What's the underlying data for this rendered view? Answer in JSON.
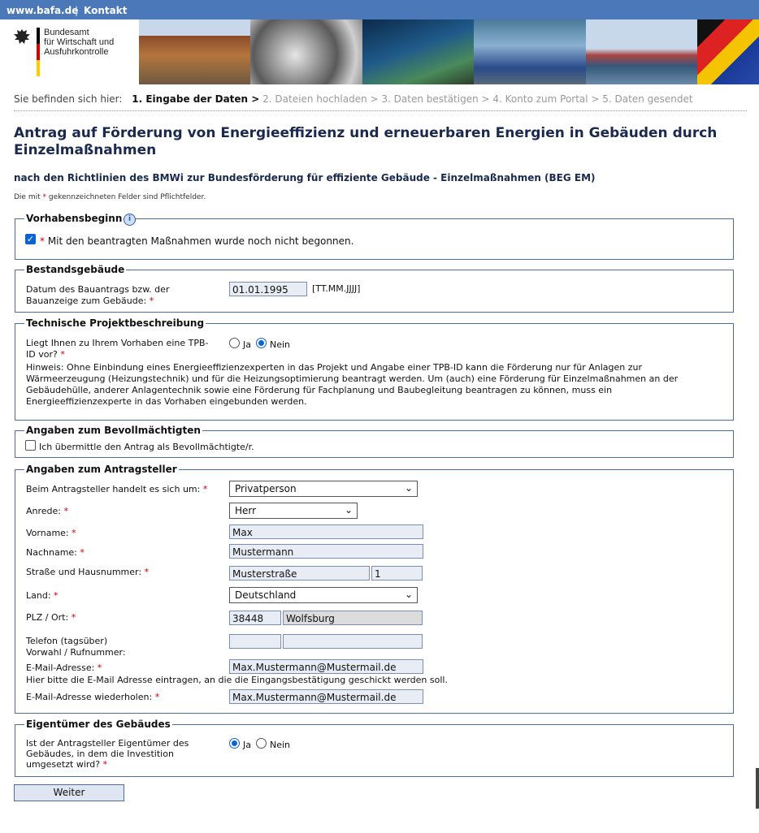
{
  "topbar": {
    "site": "www.bafa.de",
    "sep": "|",
    "contact": "Kontakt"
  },
  "logo": {
    "line1": "Bundesamt",
    "line2": "für Wirtschaft und",
    "line3": "Ausfuhrkontrolle"
  },
  "breadcrumb": {
    "prefix": "Sie befinden sich hier:",
    "current": "1. Eingabe der Daten >",
    "rest": "2. Dateien hochladen > 3. Daten bestätigen > 4. Konto zum Portal > 5. Daten gesendet"
  },
  "page": {
    "title": "Antrag auf Förderung von Energieeffizienz und erneuerbaren Energien in Gebäuden durch Einzelmaßnahmen",
    "subtitle": "nach den Richtlinien des BMWi zur Bundesförderung für effiziente Gebäude - Einzelmaßnahmen (BEG EM)",
    "req_note_pre": "Die mit ",
    "req_star": "*",
    "req_note_post": " gekennzeichneten Felder sind Pflichtfelder."
  },
  "vorhaben": {
    "legend": "Vorhabensbeginn",
    "info": "i",
    "checkbox_label": "Mit den beantragten Maßnahmen wurde noch nicht begonnen.",
    "checked": true
  },
  "bestand": {
    "legend": "Bestandsgebäude",
    "label_line1": "Datum des Bauantrags bzw. der",
    "label_line2": "Bauanzeige zum Gebäude:",
    "value": "01.01.1995",
    "format": "[TT.MM.JJJJ]"
  },
  "technik": {
    "legend": "Technische Projektbeschreibung",
    "question_line1": "Liegt Ihnen zu Ihrem Vorhaben eine TPB-",
    "question_line2": "ID vor?",
    "yes": "Ja",
    "no": "Nein",
    "selected": "Nein",
    "hint": "Hinweis: Ohne Einbindung eines Energieeffizienzexperten in das Projekt und Angabe einer TPB-ID kann die Förderung nur für Anlagen zur Wärmeerzeugung (Heizungstechnik) und für die Heizungsoptimierung beantragt werden. Um (auch) eine Förderung für Einzelmaßnahmen an der Gebäudehülle, anderer Anlagentechnik sowie eine Förderung für Fachplanung und Baubegleitung beantragen zu können, muss ein Energieeffizienzexperte in das Vorhaben eingebunden werden."
  },
  "bevoll": {
    "legend": "Angaben zum Bevollmächtigten",
    "checkbox_label": "Ich übermittle den Antrag als Bevollmächtigte/r.",
    "checked": false
  },
  "antrag": {
    "legend": "Angaben zum Antragsteller",
    "typ_label": "Beim Antragsteller handelt es sich um:",
    "typ_value": "Privatperson",
    "anrede_label": "Anrede:",
    "anrede_value": "Herr",
    "vorname_label": "Vorname:",
    "vorname_value": "Max",
    "nachname_label": "Nachname:",
    "nachname_value": "Mustermann",
    "strasse_label": "Straße und Hausnummer:",
    "strasse_value": "Musterstraße",
    "hausnr_value": "1",
    "land_label": "Land:",
    "land_value": "Deutschland",
    "plz_label": "PLZ / Ort:",
    "plz_value": "38448",
    "ort_value": "Wolfsburg",
    "telefon_label_line1": "Telefon (tagsüber)",
    "telefon_label_line2": "Vorwahl / Rufnummer:",
    "vorwahl_value": "",
    "rufnummer_value": "",
    "email_label": "E-Mail-Adresse:",
    "email_value": "Max.Mustermann@Mustermail.de",
    "email_hint": "Hier bitte die E-Mail Adresse eintragen, an die die Eingangsbestätigung geschickt werden soll.",
    "email2_label": "E-Mail-Adresse wiederholen:",
    "email2_value": "Max.Mustermann@Mustermail.de"
  },
  "eigent": {
    "legend": "Eigentümer des Gebäudes",
    "q_line1": "Ist der Antragsteller Eigentümer des",
    "q_line2": "Gebäudes, in dem die Investition",
    "q_line3": "umgesetzt wird?",
    "yes": "Ja",
    "no": "Nein",
    "selected": "Ja"
  },
  "actions": {
    "next": "Weiter"
  },
  "colors": {
    "topbar": "#4a78b8",
    "title": "#1a2a4f",
    "required": "#cc0000",
    "checked": "#0a64d8",
    "border": "#4a6fa8"
  }
}
